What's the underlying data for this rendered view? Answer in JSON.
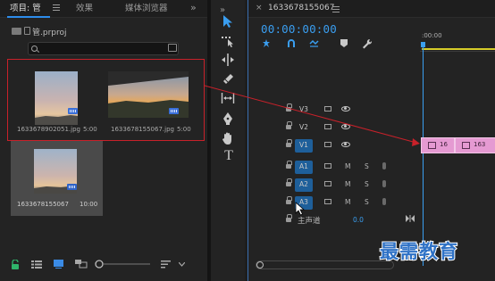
{
  "project_panel": {
    "tabs": [
      {
        "label": "项目: 管",
        "active": true
      },
      {
        "label": "效果",
        "active": false
      },
      {
        "label": "媒体浏览器",
        "active": false
      }
    ],
    "more_glyph": "»",
    "project_file": "管.prproj",
    "search_placeholder": "",
    "clips": [
      {
        "name": "1633678902051.jpg",
        "duration": "5:00",
        "thumb": "sunset-soft",
        "selected": true
      },
      {
        "name": "1633678155067.jpg",
        "duration": "5:00",
        "thumb": "sunset-window",
        "selected": true
      },
      {
        "name": "1633678155067",
        "duration": "10:00",
        "thumb": "sunset-soft",
        "selected": false,
        "highlighted": true
      }
    ],
    "bottom_toolbar_icons": [
      "lock-icon",
      "list-view-icon",
      "icon-view-icon",
      "freeform-view-icon",
      "zoom-slider",
      "sort-icon",
      "chevron-down-icon",
      "new-item-icon",
      "folder-icon"
    ]
  },
  "tools_panel": {
    "more_glyph": "»",
    "tools": [
      "selection-tool-icon",
      "track-select-icon",
      "ripple-edit-icon",
      "razor-icon",
      "slip-icon",
      "pen-icon",
      "hand-icon",
      "type-icon"
    ],
    "type_glyph": "T"
  },
  "timeline": {
    "close_glyph": "×",
    "sequence_name": "1633678155067",
    "timecode": "00:00:00:00",
    "ruler_label": ":00:00",
    "tracks": [
      {
        "name": "V3",
        "kind": "video",
        "target": false
      },
      {
        "name": "V2",
        "kind": "video",
        "target": false
      },
      {
        "name": "V1",
        "kind": "video",
        "target": true
      },
      {
        "name": "A1",
        "kind": "audio",
        "target": true
      },
      {
        "name": "A2",
        "kind": "audio",
        "target": true
      },
      {
        "name": "A3",
        "kind": "audio",
        "target": true
      }
    ],
    "audio_labels": {
      "mute": "M",
      "solo": "S"
    },
    "master_label": "主声道",
    "master_value": "0.0",
    "clips": [
      {
        "label": "16",
        "track": "V1"
      },
      {
        "label": "163",
        "track": "V1"
      }
    ],
    "colors": {
      "timecode": "#3a9ef0",
      "clip": "#e59ad2",
      "work_area": "#d6cc29",
      "target": "#1e5f9a"
    }
  },
  "watermark": "最需教育",
  "annotation": {
    "color": "#c8212a"
  }
}
